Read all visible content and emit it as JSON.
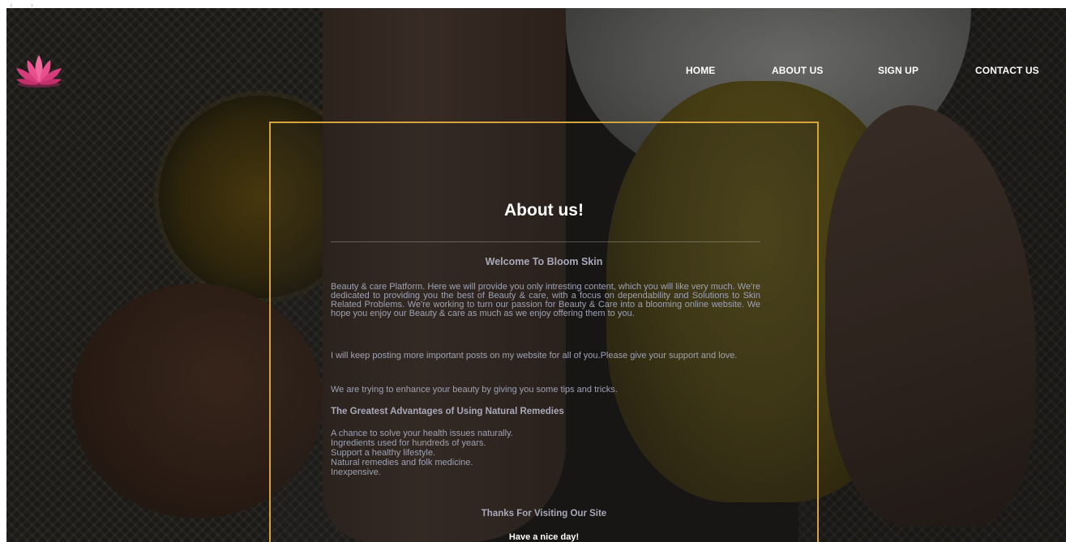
{
  "browser": {
    "back_arrow": "‹",
    "forward_arrow": "›"
  },
  "header": {
    "logo_icon": "lotus-icon",
    "nav": [
      {
        "label": "HOME"
      },
      {
        "label": "ABOUT US"
      },
      {
        "label": "SIGN UP"
      },
      {
        "label": "CONTACT US"
      }
    ]
  },
  "about": {
    "title": "About us!",
    "welcome": "Welcome To Bloom Skin",
    "paragraphs": [
      "Beauty & care Platform. Here we will provide you only intresting content, which you will like very much. We're dedicated to providing you the best of Beauty & care, with a focus on dependability and Solutions to Skin Related Problems. We're working to turn our passion for Beauty & Care into a blooming online website. We hope you enjoy our Beauty & care as much as we enjoy offering them to you.",
      "I will keep posting more important posts on my website for all of you.Please give your support and love.",
      "We are trying to enhance your beauty by giving you some tips and tricks."
    ],
    "advantages_heading": "The Greatest Advantages of Using Natural Remedies",
    "advantages": [
      "A chance to solve your health issues naturally.",
      "Ingredients used for hundreds of years.",
      "Support a healthy lifestyle.",
      "Natural remedies and folk medicine.",
      "Inexpensive."
    ],
    "thanks": "Thanks For Visiting Our Site",
    "closing": "Have a nice day!"
  },
  "colors": {
    "card_border": "#d7a43b",
    "nav_text": "#ffffff",
    "body_text": "#9ea2b3"
  }
}
